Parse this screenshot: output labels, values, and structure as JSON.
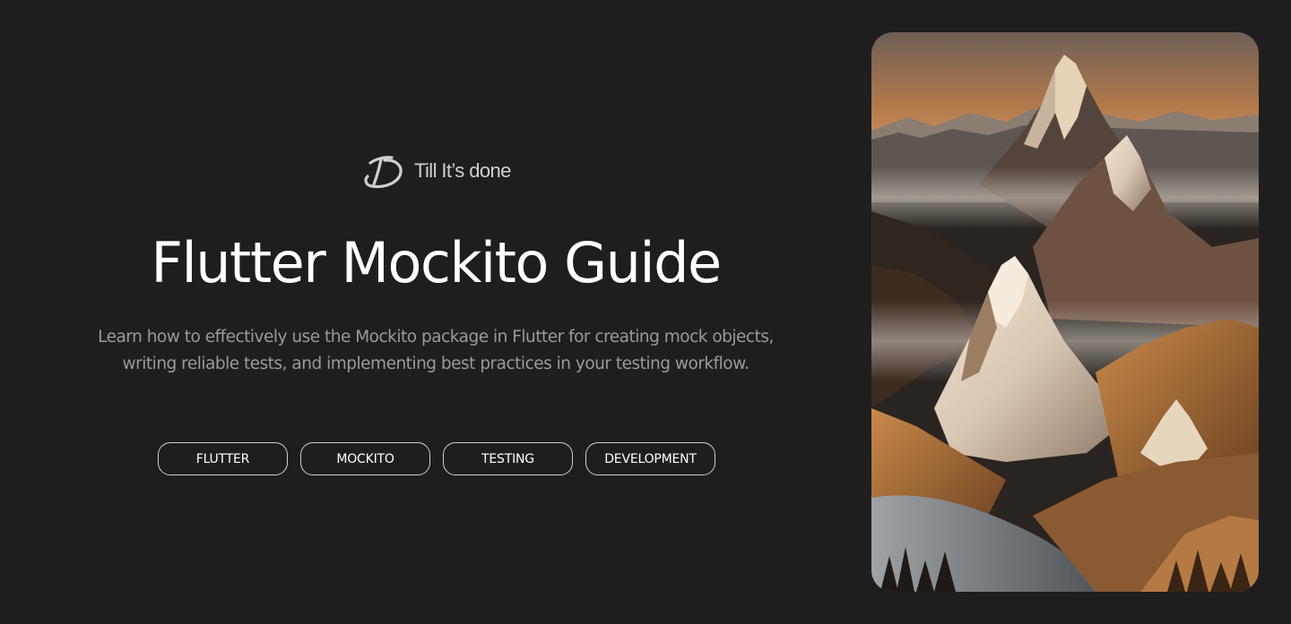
{
  "brand": {
    "name": "Till It’s done",
    "logo_icon": "td-monogram-icon"
  },
  "hero": {
    "title": "Flutter Mockito Guide",
    "description_line1": "Learn how to effectively use the Mockito package in Flutter for creating mock objects,",
    "description_line2": "writing reliable tests, and implementing best practices in your testing workflow.",
    "tags": [
      {
        "label": "FLUTTER"
      },
      {
        "label": "MOCKITO"
      },
      {
        "label": "TESTING"
      },
      {
        "label": "DEVELOPMENT"
      }
    ]
  },
  "cover_image": {
    "subject": "mountain-landscape-illustration"
  },
  "colors": {
    "background": "#1e1e1e",
    "title": "#ffffff",
    "description": "#9a9a9a",
    "tag_border": "#cfcfcf",
    "brand_text": "#cfcfcf"
  }
}
